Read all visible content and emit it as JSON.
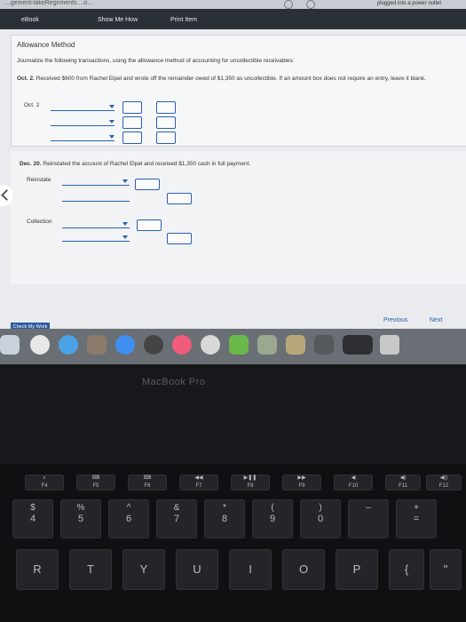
{
  "browser": {
    "url_fragment": "...gement-takeRegnments....o...",
    "status": "plugged into a power outlet"
  },
  "toolbar": {
    "ebook": "eBook",
    "show_me_how": "Show Me How",
    "print_item": "Print Item"
  },
  "panel": {
    "title": "Allowance Method",
    "instruction": "Journalize the following transactions, using the allowance method of accounting for uncollectible receivables:",
    "oct_label": "Oct. 2.",
    "oct_text": "Received $600 from Rachel Elpel and wrote off the remainder owed of $1,350 as uncollectible. If an amount box does not require an entry, leave it blank.",
    "oct_date": "Oct. 2"
  },
  "dec": {
    "label": "Dec. 20.",
    "text": "Reinstated the account of Rachel Elpel and received $1,350 cash in full payment.",
    "reinstate": "Reinstate",
    "collection": "Collection"
  },
  "nav": {
    "check": "Check My Work",
    "previous": "Previous",
    "next": "Next"
  },
  "laptop": {
    "brand": "MacBook Pro"
  },
  "fkeys": [
    "F4",
    "F5",
    "F6",
    "F7",
    "F8",
    "F9",
    "F10",
    "F11",
    "F12"
  ],
  "number_keys": [
    {
      "top": "$",
      "bottom": "4"
    },
    {
      "top": "%",
      "bottom": "5"
    },
    {
      "top": "^",
      "bottom": "6"
    },
    {
      "top": "&",
      "bottom": "7"
    },
    {
      "top": "*",
      "bottom": "8"
    },
    {
      "top": "(",
      "bottom": "9"
    },
    {
      "top": ")",
      "bottom": "0"
    },
    {
      "top": "–",
      "bottom": ""
    },
    {
      "top": "+",
      "bottom": "="
    }
  ],
  "letter_keys": [
    "R",
    "T",
    "Y",
    "U",
    "I",
    "O",
    "P",
    "{",
    "\""
  ]
}
